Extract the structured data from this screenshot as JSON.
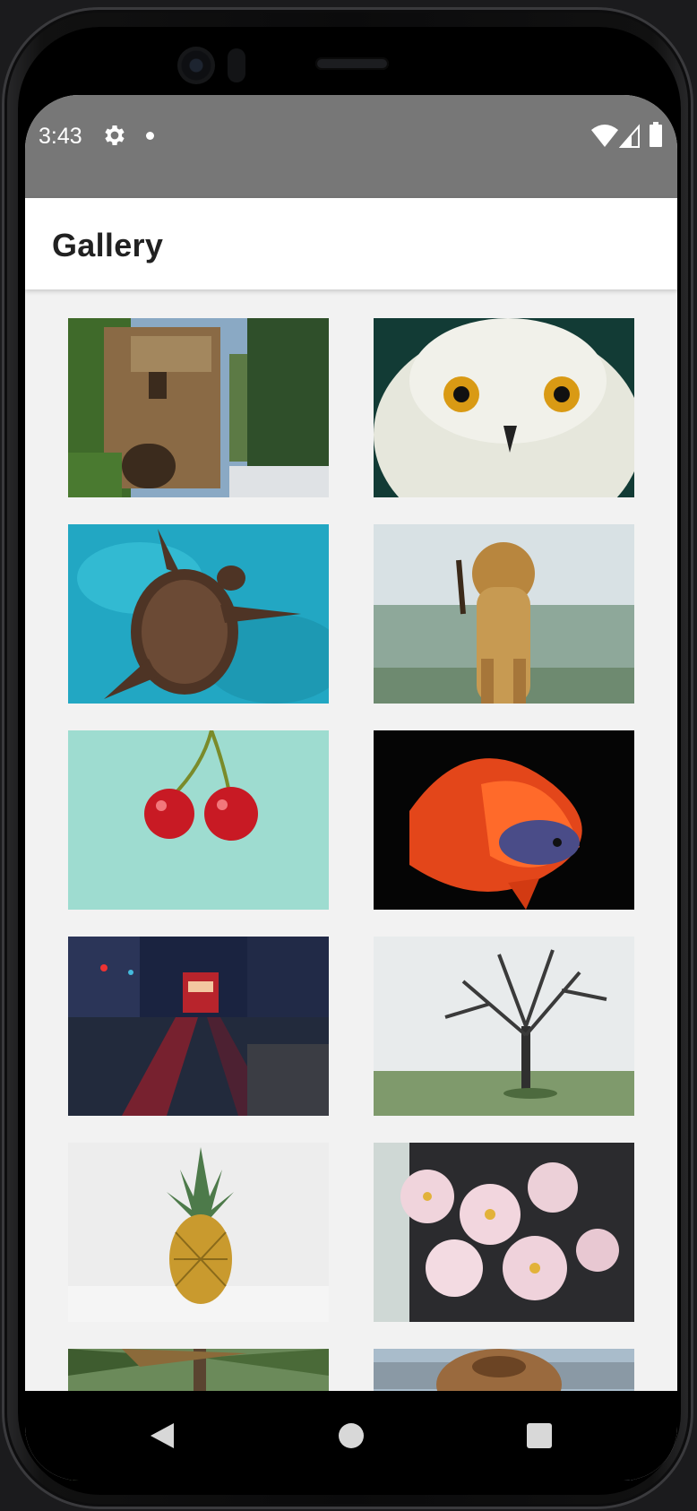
{
  "status_bar": {
    "time": "3:43",
    "icons": [
      "settings-icon",
      "notification-dot-icon",
      "wifi-icon",
      "cellular-signal-icon",
      "battery-icon"
    ]
  },
  "app_bar": {
    "title": "Gallery"
  },
  "gallery": {
    "items": [
      {
        "subject": "castle-photo"
      },
      {
        "subject": "snowy-owl-photo"
      },
      {
        "subject": "sea-turtle-photo"
      },
      {
        "subject": "lioness-photo"
      },
      {
        "subject": "cherries-photo"
      },
      {
        "subject": "betta-fish-photo"
      },
      {
        "subject": "streetcar-night-photo"
      },
      {
        "subject": "bare-tree-fog-photo"
      },
      {
        "subject": "pineapple-photo"
      },
      {
        "subject": "orchids-photo"
      },
      {
        "subject": "palm-trees-photo"
      },
      {
        "subject": "animal-partial-photo"
      }
    ]
  },
  "nav_bar": {
    "icons": [
      "back-icon",
      "home-icon",
      "recents-icon"
    ]
  },
  "colors": {
    "status_bar": "#777777",
    "app_bar": "#ffffff",
    "background": "#f2f2f2",
    "nav_bar": "#000000"
  }
}
